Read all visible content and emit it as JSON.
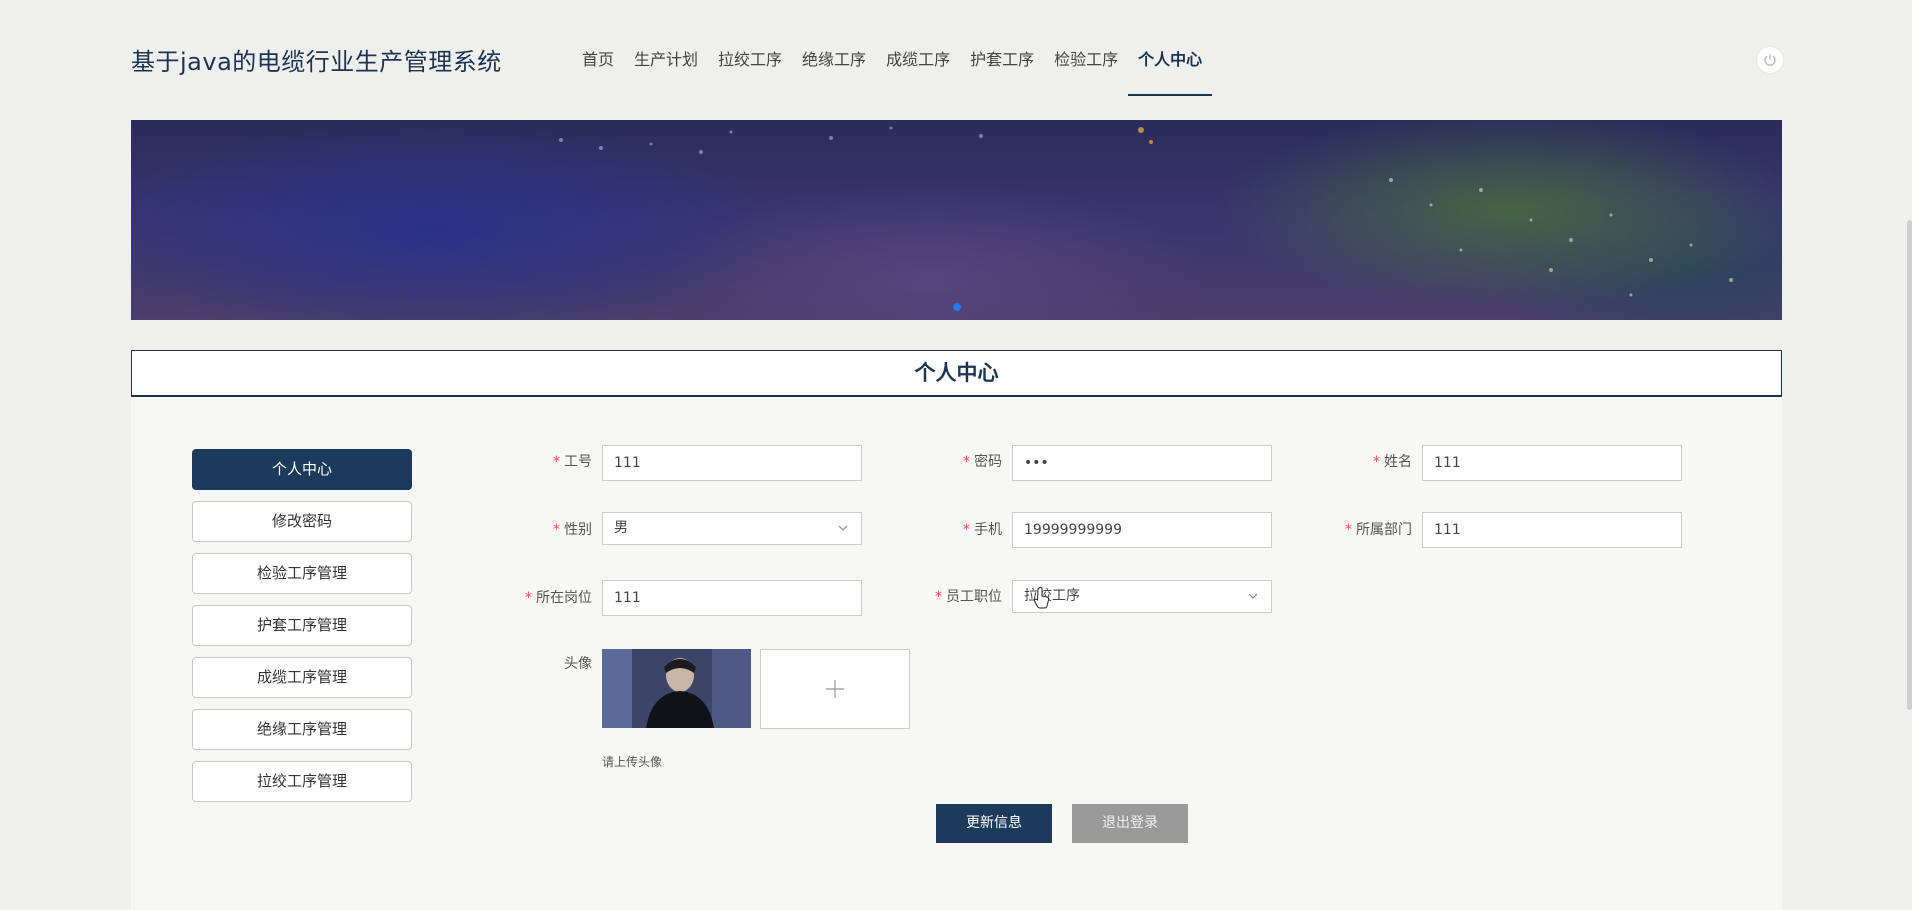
{
  "header": {
    "site_title": "基于java的电缆行业生产管理系统",
    "nav": [
      {
        "label": "首页"
      },
      {
        "label": "生产计划"
      },
      {
        "label": "拉绞工序"
      },
      {
        "label": "绝缘工序"
      },
      {
        "label": "成缆工序"
      },
      {
        "label": "护套工序"
      },
      {
        "label": "检验工序"
      },
      {
        "label": "个人中心",
        "active": true
      }
    ],
    "power_icon": "power-icon"
  },
  "section_title": "个人中心",
  "sidebar": {
    "items": [
      {
        "label": "个人中心",
        "active": true
      },
      {
        "label": "修改密码"
      },
      {
        "label": "检验工序管理"
      },
      {
        "label": "护套工序管理"
      },
      {
        "label": "成缆工序管理"
      },
      {
        "label": "绝缘工序管理"
      },
      {
        "label": "拉绞工序管理"
      }
    ]
  },
  "form": {
    "required_mark": "*",
    "job_no": {
      "label": "工号",
      "value": "111"
    },
    "password": {
      "label": "密码",
      "value": "•••"
    },
    "name": {
      "label": "姓名",
      "value": "111"
    },
    "gender": {
      "label": "性别",
      "value": "男"
    },
    "phone": {
      "label": "手机",
      "value": "19999999999"
    },
    "department": {
      "label": "所属部门",
      "value": "111"
    },
    "post": {
      "label": "所在岗位",
      "value": "111"
    },
    "position": {
      "label": "员工职位",
      "value": "拉绞工序"
    },
    "avatar": {
      "label": "头像",
      "hint": "请上传头像",
      "upload_icon": "plus-icon"
    }
  },
  "buttons": {
    "update": "更新信息",
    "logout": "退出登录"
  },
  "colors": {
    "primary": "#1c3a5c",
    "required": "#e34b4b",
    "carousel_dot": "#1e7cf0",
    "logout_button": "#9a9a9a"
  }
}
